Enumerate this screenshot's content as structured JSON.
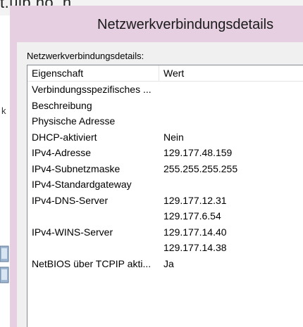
{
  "background": {
    "url_fragment": "t.uib.no_n",
    "side_letter": "k"
  },
  "dialog": {
    "title": "Netzwerkverbindungsdetails",
    "group_label": "Netzwerkverbindungsdetails:",
    "columns": {
      "property": "Eigenschaft",
      "value": "Wert"
    },
    "rows": [
      {
        "property": "Verbindungsspezifisches ...",
        "value": ""
      },
      {
        "property": "Beschreibung",
        "value": ""
      },
      {
        "property": "Physische Adresse",
        "value": ""
      },
      {
        "property": "DHCP-aktiviert",
        "value": "Nein"
      },
      {
        "property": "IPv4-Adresse",
        "value": "129.177.48.159"
      },
      {
        "property": "IPv4-Subnetzmaske",
        "value": "255.255.255.255"
      },
      {
        "property": "IPv4-Standardgateway",
        "value": ""
      },
      {
        "property": "IPv4-DNS-Server",
        "value": "129.177.12.31"
      },
      {
        "property": "",
        "value": "129.177.6.54"
      },
      {
        "property": "IPv4-WINS-Server",
        "value": "129.177.14.40"
      },
      {
        "property": "",
        "value": "129.177.14.38"
      },
      {
        "property": "NetBIOS über TCPIP akti...",
        "value": "Ja"
      }
    ]
  },
  "colors": {
    "dialog_frame": "#e6cfe1",
    "client_background": "#f0f0f0",
    "list_background": "#ffffff"
  }
}
